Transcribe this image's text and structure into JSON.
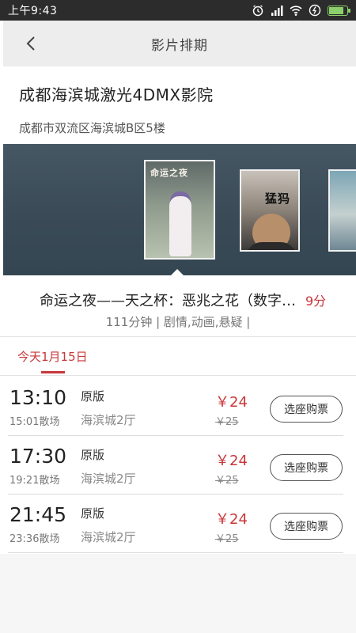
{
  "status_bar": {
    "time": "上午9:43",
    "icons": [
      "alarm-icon",
      "signal-icon",
      "wifi-icon",
      "power-saving-icon",
      "battery-icon"
    ],
    "signal_label": "HD"
  },
  "header": {
    "title": "影片排期",
    "back_icon": "chevron-left-icon"
  },
  "cinema": {
    "name": "成都海滨城激光4DMX影院",
    "address": "成都市双流区海滨城B区5楼"
  },
  "posters": [
    {
      "title_text": "命运之夜",
      "selected": true
    },
    {
      "title_text": "猛犸",
      "selected": false
    },
    {
      "title_text": "",
      "selected": false
    }
  ],
  "movie": {
    "title": "命运之夜——天之杯：恶兆之花（数字…",
    "score": "9分",
    "meta": "111分钟 | 剧情,动画,悬疑 |"
  },
  "date_tabs": [
    {
      "label": "今天1月15日",
      "active": true
    }
  ],
  "showtimes": [
    {
      "start": "13:10",
      "end": "15:01散场",
      "version": "原版",
      "hall": "海滨城2厅",
      "price": "￥24",
      "original_price": "￥25",
      "button": "选座购票"
    },
    {
      "start": "17:30",
      "end": "19:21散场",
      "version": "原版",
      "hall": "海滨城2厅",
      "price": "￥24",
      "original_price": "￥25",
      "button": "选座购票"
    },
    {
      "start": "21:45",
      "end": "23:36散场",
      "version": "原版",
      "hall": "海滨城2厅",
      "price": "￥24",
      "original_price": "￥25",
      "button": "选座购票"
    }
  ],
  "colors": {
    "accent": "#c8373a",
    "header_bg": "#ededed",
    "status_bar_bg": "#2c2c2c",
    "battery": "#8bd06b"
  }
}
